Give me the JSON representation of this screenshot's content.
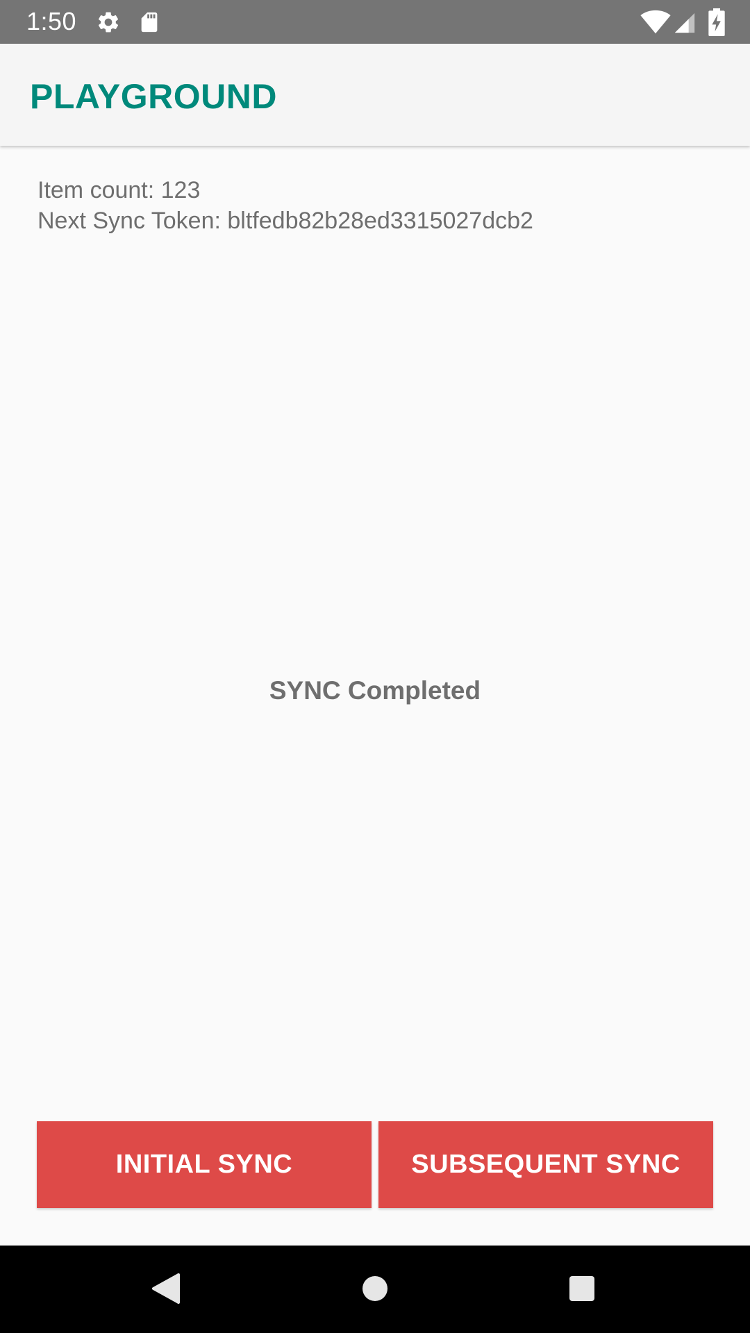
{
  "status_bar": {
    "time": "1:50",
    "icons": [
      "settings-icon",
      "sd-card-icon",
      "wifi-icon",
      "signal-icon",
      "battery-charging-icon"
    ],
    "icon_color": "#ffffff",
    "background": "#757575"
  },
  "app_bar": {
    "title": "PLAYGROUND",
    "title_color": "#00897b"
  },
  "info": {
    "item_count": "Item count: 123",
    "sync_token": "Next Sync Token: bltfedb82b28ed3315027dcb2"
  },
  "status": {
    "message": "SYNC Completed"
  },
  "buttons": {
    "initial_sync": "INITIAL SYNC",
    "subsequent_sync": "SUBSEQUENT SYNC",
    "color": "#de4a48"
  },
  "nav_bar": {
    "icons": [
      "back-icon",
      "home-icon",
      "recents-icon"
    ]
  }
}
